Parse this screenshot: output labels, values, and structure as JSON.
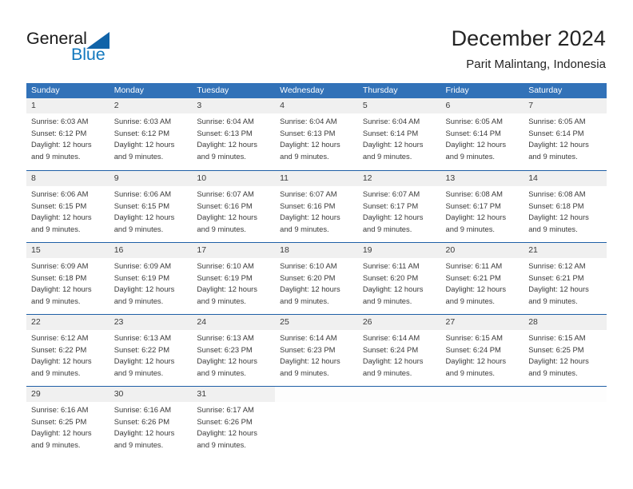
{
  "logo": {
    "text_general": "General",
    "text_blue": "Blue",
    "triangle_color": "#1063a8",
    "general_color": "#1a1a1a",
    "blue_color": "#1278be"
  },
  "header": {
    "title": "December 2024",
    "subtitle": "Parit Malintang, Indonesia"
  },
  "theme": {
    "header_bg": "#3272b8",
    "row_border": "#1f5fa6",
    "day_band_bg": "#f0f0f0",
    "text_color": "#3a3a3a"
  },
  "weekdays": [
    "Sunday",
    "Monday",
    "Tuesday",
    "Wednesday",
    "Thursday",
    "Friday",
    "Saturday"
  ],
  "weeks": [
    [
      {
        "day": "1",
        "sunrise": "Sunrise: 6:03 AM",
        "sunset": "Sunset: 6:12 PM",
        "daylight1": "Daylight: 12 hours",
        "daylight2": "and 9 minutes."
      },
      {
        "day": "2",
        "sunrise": "Sunrise: 6:03 AM",
        "sunset": "Sunset: 6:12 PM",
        "daylight1": "Daylight: 12 hours",
        "daylight2": "and 9 minutes."
      },
      {
        "day": "3",
        "sunrise": "Sunrise: 6:04 AM",
        "sunset": "Sunset: 6:13 PM",
        "daylight1": "Daylight: 12 hours",
        "daylight2": "and 9 minutes."
      },
      {
        "day": "4",
        "sunrise": "Sunrise: 6:04 AM",
        "sunset": "Sunset: 6:13 PM",
        "daylight1": "Daylight: 12 hours",
        "daylight2": "and 9 minutes."
      },
      {
        "day": "5",
        "sunrise": "Sunrise: 6:04 AM",
        "sunset": "Sunset: 6:14 PM",
        "daylight1": "Daylight: 12 hours",
        "daylight2": "and 9 minutes."
      },
      {
        "day": "6",
        "sunrise": "Sunrise: 6:05 AM",
        "sunset": "Sunset: 6:14 PM",
        "daylight1": "Daylight: 12 hours",
        "daylight2": "and 9 minutes."
      },
      {
        "day": "7",
        "sunrise": "Sunrise: 6:05 AM",
        "sunset": "Sunset: 6:14 PM",
        "daylight1": "Daylight: 12 hours",
        "daylight2": "and 9 minutes."
      }
    ],
    [
      {
        "day": "8",
        "sunrise": "Sunrise: 6:06 AM",
        "sunset": "Sunset: 6:15 PM",
        "daylight1": "Daylight: 12 hours",
        "daylight2": "and 9 minutes."
      },
      {
        "day": "9",
        "sunrise": "Sunrise: 6:06 AM",
        "sunset": "Sunset: 6:15 PM",
        "daylight1": "Daylight: 12 hours",
        "daylight2": "and 9 minutes."
      },
      {
        "day": "10",
        "sunrise": "Sunrise: 6:07 AM",
        "sunset": "Sunset: 6:16 PM",
        "daylight1": "Daylight: 12 hours",
        "daylight2": "and 9 minutes."
      },
      {
        "day": "11",
        "sunrise": "Sunrise: 6:07 AM",
        "sunset": "Sunset: 6:16 PM",
        "daylight1": "Daylight: 12 hours",
        "daylight2": "and 9 minutes."
      },
      {
        "day": "12",
        "sunrise": "Sunrise: 6:07 AM",
        "sunset": "Sunset: 6:17 PM",
        "daylight1": "Daylight: 12 hours",
        "daylight2": "and 9 minutes."
      },
      {
        "day": "13",
        "sunrise": "Sunrise: 6:08 AM",
        "sunset": "Sunset: 6:17 PM",
        "daylight1": "Daylight: 12 hours",
        "daylight2": "and 9 minutes."
      },
      {
        "day": "14",
        "sunrise": "Sunrise: 6:08 AM",
        "sunset": "Sunset: 6:18 PM",
        "daylight1": "Daylight: 12 hours",
        "daylight2": "and 9 minutes."
      }
    ],
    [
      {
        "day": "15",
        "sunrise": "Sunrise: 6:09 AM",
        "sunset": "Sunset: 6:18 PM",
        "daylight1": "Daylight: 12 hours",
        "daylight2": "and 9 minutes."
      },
      {
        "day": "16",
        "sunrise": "Sunrise: 6:09 AM",
        "sunset": "Sunset: 6:19 PM",
        "daylight1": "Daylight: 12 hours",
        "daylight2": "and 9 minutes."
      },
      {
        "day": "17",
        "sunrise": "Sunrise: 6:10 AM",
        "sunset": "Sunset: 6:19 PM",
        "daylight1": "Daylight: 12 hours",
        "daylight2": "and 9 minutes."
      },
      {
        "day": "18",
        "sunrise": "Sunrise: 6:10 AM",
        "sunset": "Sunset: 6:20 PM",
        "daylight1": "Daylight: 12 hours",
        "daylight2": "and 9 minutes."
      },
      {
        "day": "19",
        "sunrise": "Sunrise: 6:11 AM",
        "sunset": "Sunset: 6:20 PM",
        "daylight1": "Daylight: 12 hours",
        "daylight2": "and 9 minutes."
      },
      {
        "day": "20",
        "sunrise": "Sunrise: 6:11 AM",
        "sunset": "Sunset: 6:21 PM",
        "daylight1": "Daylight: 12 hours",
        "daylight2": "and 9 minutes."
      },
      {
        "day": "21",
        "sunrise": "Sunrise: 6:12 AM",
        "sunset": "Sunset: 6:21 PM",
        "daylight1": "Daylight: 12 hours",
        "daylight2": "and 9 minutes."
      }
    ],
    [
      {
        "day": "22",
        "sunrise": "Sunrise: 6:12 AM",
        "sunset": "Sunset: 6:22 PM",
        "daylight1": "Daylight: 12 hours",
        "daylight2": "and 9 minutes."
      },
      {
        "day": "23",
        "sunrise": "Sunrise: 6:13 AM",
        "sunset": "Sunset: 6:22 PM",
        "daylight1": "Daylight: 12 hours",
        "daylight2": "and 9 minutes."
      },
      {
        "day": "24",
        "sunrise": "Sunrise: 6:13 AM",
        "sunset": "Sunset: 6:23 PM",
        "daylight1": "Daylight: 12 hours",
        "daylight2": "and 9 minutes."
      },
      {
        "day": "25",
        "sunrise": "Sunrise: 6:14 AM",
        "sunset": "Sunset: 6:23 PM",
        "daylight1": "Daylight: 12 hours",
        "daylight2": "and 9 minutes."
      },
      {
        "day": "26",
        "sunrise": "Sunrise: 6:14 AM",
        "sunset": "Sunset: 6:24 PM",
        "daylight1": "Daylight: 12 hours",
        "daylight2": "and 9 minutes."
      },
      {
        "day": "27",
        "sunrise": "Sunrise: 6:15 AM",
        "sunset": "Sunset: 6:24 PM",
        "daylight1": "Daylight: 12 hours",
        "daylight2": "and 9 minutes."
      },
      {
        "day": "28",
        "sunrise": "Sunrise: 6:15 AM",
        "sunset": "Sunset: 6:25 PM",
        "daylight1": "Daylight: 12 hours",
        "daylight2": "and 9 minutes."
      }
    ],
    [
      {
        "day": "29",
        "sunrise": "Sunrise: 6:16 AM",
        "sunset": "Sunset: 6:25 PM",
        "daylight1": "Daylight: 12 hours",
        "daylight2": "and 9 minutes."
      },
      {
        "day": "30",
        "sunrise": "Sunrise: 6:16 AM",
        "sunset": "Sunset: 6:26 PM",
        "daylight1": "Daylight: 12 hours",
        "daylight2": "and 9 minutes."
      },
      {
        "day": "31",
        "sunrise": "Sunrise: 6:17 AM",
        "sunset": "Sunset: 6:26 PM",
        "daylight1": "Daylight: 12 hours",
        "daylight2": "and 9 minutes."
      },
      {
        "day": "",
        "sunrise": "",
        "sunset": "",
        "daylight1": "",
        "daylight2": ""
      },
      {
        "day": "",
        "sunrise": "",
        "sunset": "",
        "daylight1": "",
        "daylight2": ""
      },
      {
        "day": "",
        "sunrise": "",
        "sunset": "",
        "daylight1": "",
        "daylight2": ""
      },
      {
        "day": "",
        "sunrise": "",
        "sunset": "",
        "daylight1": "",
        "daylight2": ""
      }
    ]
  ]
}
